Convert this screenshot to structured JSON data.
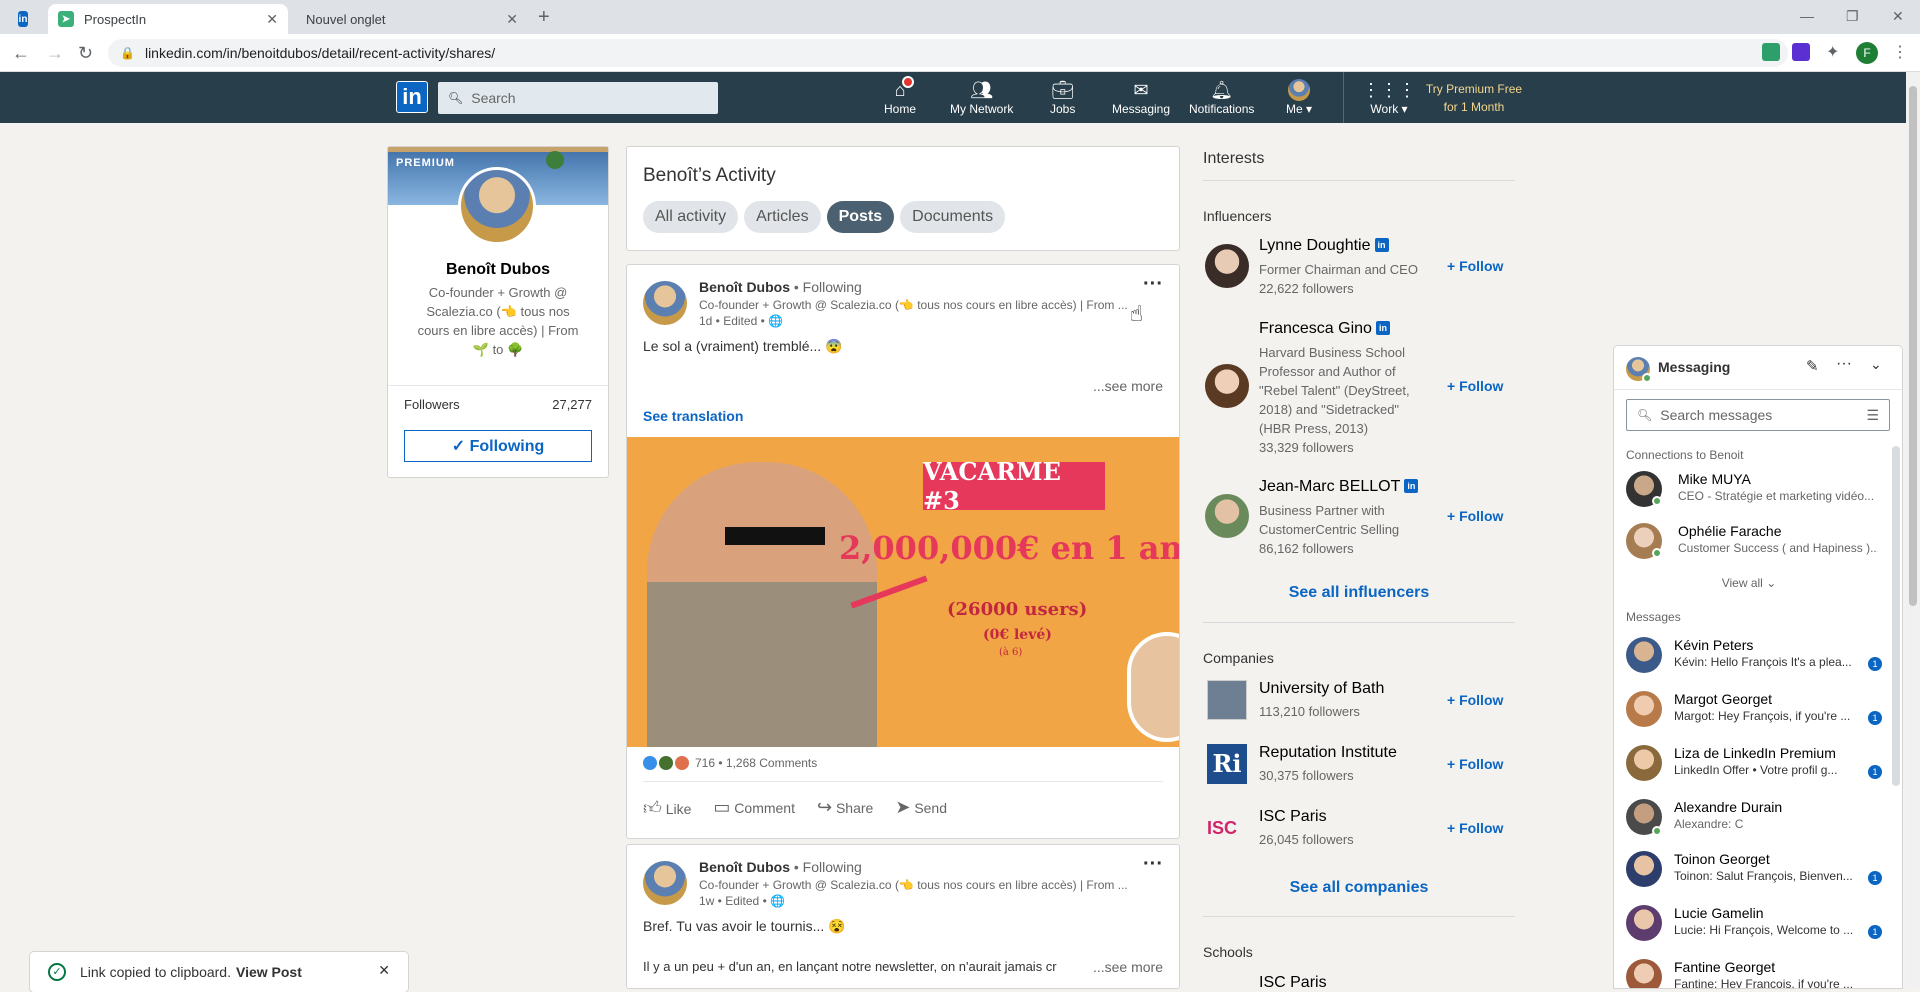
{
  "browser": {
    "tabs": [
      {
        "title": "ProspectIn"
      },
      {
        "title": "Nouvel onglet"
      }
    ],
    "url": "linkedin.com/in/benoitdubos/detail/recent-activity/shares/"
  },
  "header": {
    "search_placeholder": "Search",
    "nav": [
      {
        "label": "Home",
        "icon": "home-icon"
      },
      {
        "label": "My Network",
        "icon": "network-icon"
      },
      {
        "label": "Jobs",
        "icon": "jobs-icon"
      },
      {
        "label": "Messaging",
        "icon": "messaging-icon"
      },
      {
        "label": "Notifications",
        "icon": "bell-icon"
      },
      {
        "label": "Me",
        "icon": "avatar"
      },
      {
        "label": "Work",
        "icon": "grid-icon"
      }
    ],
    "premium_line1": "Try Premium Free",
    "premium_line2": "for 1 Month"
  },
  "profile": {
    "badge": "PREMIUM",
    "name": "Benoît Dubos",
    "headline_1": "Co-founder + Growth @",
    "headline_2": "Scalezia.co (👈 tous nos",
    "headline_3": "cours en libre accès) | From",
    "headline_4": "🌱 to 🌳",
    "followers_label": "Followers",
    "followers_count": "27,277",
    "following_label": "✓ Following"
  },
  "activity": {
    "title": "Benoît’s Activity",
    "tabs": [
      "All activity",
      "Articles",
      "Posts",
      "Documents"
    ],
    "selected_tab": "Posts"
  },
  "post1": {
    "author": "Benoît Dubos",
    "relation": "• Following",
    "headline": "Co-founder + Growth @ Scalezia.co (👈 tous nos cours en libre accès) | From ...",
    "meta": "1d • Edited • 🌐",
    "text": "Le sol a (vraiment) tremblé... 😨",
    "see_more": "...see more",
    "see_translation": "See translation",
    "image": {
      "badge": "VACARME #3",
      "line1": "2,000,000€ en 1 an",
      "line2": "(26000 users)",
      "line3": "(0€ levé)",
      "line4": "(à 6)"
    },
    "reactions": "716 • 1,268 Comments",
    "actions": [
      "Like",
      "Comment",
      "Share",
      "Send"
    ]
  },
  "post2": {
    "author": "Benoît Dubos",
    "relation": "• Following",
    "headline": "Co-founder + Growth @ Scalezia.co (👈 tous nos cours en libre accès) | From ...",
    "meta": "1w • Edited • 🌐",
    "text": "Bref. Tu vas avoir le tournis... 😵",
    "text2": "Il y a un peu + d'un an, en lançant notre newsletter, on n'aurait jamais cr",
    "see_more": "...see more"
  },
  "interests": {
    "title": "Interests",
    "influencers_title": "Influencers",
    "influencers": [
      {
        "name": "Lynne Doughtie",
        "desc": [
          "Former Chairman and CEO",
          "22,622 followers"
        ],
        "follow": "+ Follow"
      },
      {
        "name": "Francesca Gino",
        "desc": [
          "Harvard Business School",
          "Professor and Author of",
          "\"Rebel Talent\" (DeyStreet,",
          "2018) and \"Sidetracked\"",
          "(HBR Press, 2013)",
          "33,329 followers"
        ],
        "follow": "+ Follow"
      },
      {
        "name": "Jean-Marc BELLOT",
        "desc": [
          "Business Partner with",
          "CustomerCentric Selling",
          "86,162 followers"
        ],
        "follow": "+ Follow"
      }
    ],
    "see_all_influencers": "See all influencers",
    "companies_title": "Companies",
    "companies": [
      {
        "name": "University of Bath",
        "followers": "113,210 followers",
        "follow": "+ Follow"
      },
      {
        "name": "Reputation Institute",
        "followers": "30,375 followers",
        "follow": "+ Follow"
      },
      {
        "name": "ISC Paris",
        "followers": "26,045 followers",
        "follow": "+ Follow"
      }
    ],
    "see_all_companies": "See all companies",
    "schools_title": "Schools",
    "school_first": "ISC Paris"
  },
  "messaging": {
    "title": "Messaging",
    "search_placeholder": "Search messages",
    "connections_label": "Connections to Benoit",
    "connections": [
      {
        "name": "Mike MUYA",
        "desc": "CEO - Stratégie et marketing vidéo..."
      },
      {
        "name": "Ophélie Farache",
        "desc": "Customer Success ( and Hapiness )..."
      }
    ],
    "view_all": "View all",
    "messages_label": "Messages",
    "messages": [
      {
        "name": "Kévin Peters",
        "preview": "Kévin: Hello François It's a plea...",
        "count": "1"
      },
      {
        "name": "Margot Georget",
        "preview": "Margot: Hey François, if you're ...",
        "count": "1"
      },
      {
        "name": "Liza de LinkedIn Premium",
        "preview": "LinkedIn Offer • Votre profil g...",
        "count": "1"
      },
      {
        "name": "Alexandre Durain",
        "preview": "Alexandre: C",
        "count": ""
      },
      {
        "name": "Toinon Georget",
        "preview": "Toinon: Salut François, Bienven...",
        "count": "1"
      },
      {
        "name": "Lucie Gamelin",
        "preview": "Lucie: Hi François, Welcome to ...",
        "count": "1"
      },
      {
        "name": "Fantine Georget",
        "preview": "Fantine: Hey François, if you're ...",
        "count": ""
      }
    ]
  },
  "toast": {
    "text": "Link copied to clipboard.",
    "link": "View Post"
  }
}
